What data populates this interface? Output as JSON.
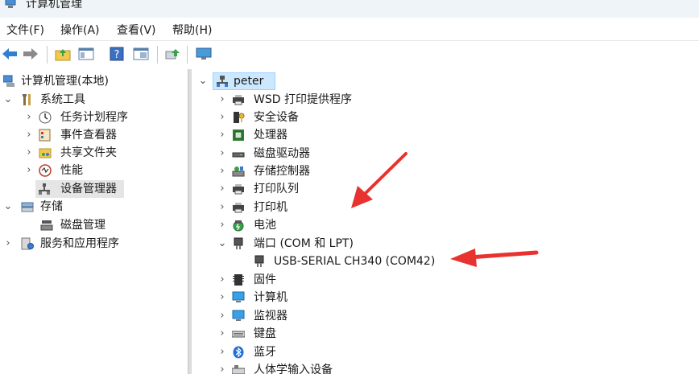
{
  "window": {
    "title": "计算机管理"
  },
  "menu": [
    "文件(F)",
    "操作(A)",
    "查看(V)",
    "帮助(H)"
  ],
  "left_tree": {
    "root": "计算机管理(本地)",
    "system_tools": "系统工具",
    "task_scheduler": "任务计划程序",
    "event_viewer": "事件查看器",
    "shared_folders": "共享文件夹",
    "performance": "性能",
    "device_manager": "设备管理器",
    "storage": "存储",
    "disk_management": "磁盘管理",
    "services_apps": "服务和应用程序"
  },
  "device_tree": {
    "root": "peter",
    "items": [
      "WSD 打印提供程序",
      "安全设备",
      "处理器",
      "磁盘驱动器",
      "存储控制器",
      "打印队列",
      "打印机",
      "电池",
      "端口 (COM 和 LPT)",
      "USB-SERIAL CH340 (COM42)",
      "固件",
      "计算机",
      "监视器",
      "键盘",
      "蓝牙",
      "人体学输入设备"
    ]
  },
  "colors": {
    "arrow": "#e8322f",
    "selection": "#cce8ff"
  }
}
